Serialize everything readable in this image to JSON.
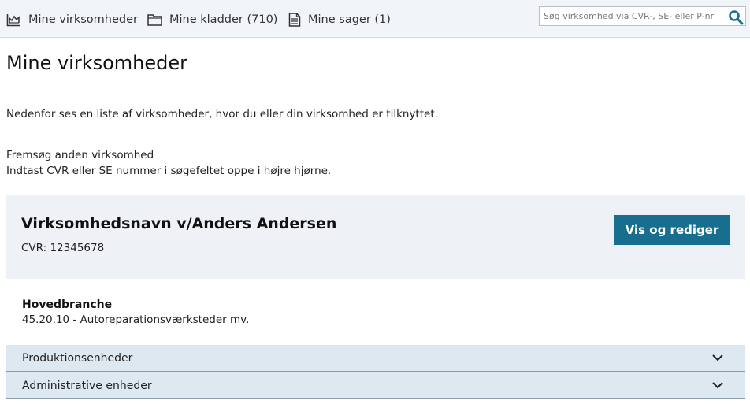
{
  "nav": {
    "items": [
      {
        "label": "Mine virksomheder",
        "icon": "chart-icon"
      },
      {
        "label": "Mine kladder (710)",
        "icon": "folder-icon"
      },
      {
        "label": "Mine sager (1)",
        "icon": "document-icon"
      }
    ]
  },
  "search": {
    "placeholder": "Søg virksomhed via CVR-, SE- eller P-nr",
    "icon": "search-icon"
  },
  "page": {
    "title": "Mine virksomheder",
    "intro": "Nedenfor ses en liste af virksomheder, hvor du eller din virksomhed er tilknyttet.",
    "search_help_title": "Fremsøg anden virksomhed",
    "search_help_text": "Indtast CVR eller SE nummer i søgefeltet oppe i højre hjørne."
  },
  "company": {
    "name": "Virksomhedsnavn v/Anders Andersen",
    "cvr": "CVR: 12345678",
    "edit_button": "Vis og rediger",
    "main_branch_label": "Hovedbranche",
    "main_branch_value": "45.20.10 - Autoreparationsværksteder mv.",
    "sections": [
      {
        "label": "Produktionsenheder"
      },
      {
        "label": "Administrative enheder"
      }
    ]
  },
  "colors": {
    "accent": "#176e8e",
    "topbar_bg": "#f1f4f8",
    "card_bg": "#eef2f6",
    "accordion_bg": "#dde8f0"
  }
}
